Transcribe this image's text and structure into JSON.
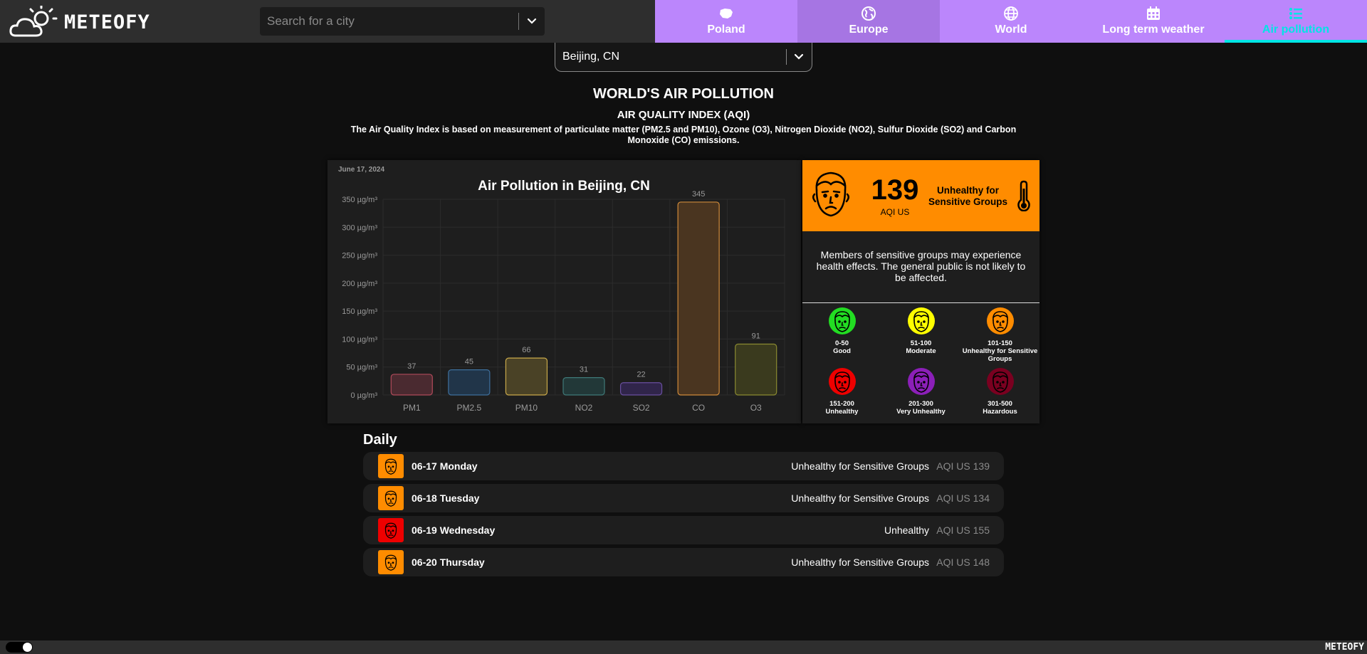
{
  "header": {
    "logo_text": "METEOFY",
    "search_placeholder": "Search for a city",
    "nav": [
      {
        "label": "Poland",
        "icon": "poland-map-icon"
      },
      {
        "label": "Europe",
        "icon": "globe-europe-icon"
      },
      {
        "label": "World",
        "icon": "globe-icon"
      },
      {
        "label": "Long term weather",
        "icon": "calendar-icon"
      },
      {
        "label": "Air pollution",
        "icon": "list-icon"
      }
    ],
    "accent": "#bb86fc",
    "active_color": "#00e5e5"
  },
  "city_select": {
    "value": "Beijing, CN"
  },
  "page": {
    "title": "WORLD'S AIR POLLUTION",
    "aqi_title": "AIR QUALITY INDEX (AQI)",
    "aqi_description": "The Air Quality Index is based on measurement of particulate matter (PM2.5 and PM10), Ozone (O3), Nitrogen Dioxide (NO2), Sulfur Dioxide (SO2) and Carbon Monoxide (CO) emissions."
  },
  "chart_date": "June 17, 2024",
  "chart_data": {
    "type": "bar",
    "title": "Air Pollution in Beijing, CN",
    "categories": [
      "PM1",
      "PM2.5",
      "PM10",
      "NO2",
      "SO2",
      "CO",
      "O3"
    ],
    "values": [
      37,
      45,
      66,
      31,
      22,
      345,
      91
    ],
    "y_ticks": [
      "0 µg/m³",
      "50 µg/m³",
      "100 µg/m³",
      "150 µg/m³",
      "200 µg/m³",
      "250 µg/m³",
      "300 µg/m³",
      "350 µg/m³"
    ],
    "ylim": [
      0,
      350
    ],
    "grid": true,
    "bar_colors": [
      {
        "fill": "#4a2a30",
        "stroke": "#b04a5a"
      },
      {
        "fill": "#213549",
        "stroke": "#3e6f9c"
      },
      {
        "fill": "#4a4226",
        "stroke": "#c9a94a"
      },
      {
        "fill": "#223838",
        "stroke": "#3f7a78"
      },
      {
        "fill": "#30254a",
        "stroke": "#6a4fa0"
      },
      {
        "fill": "#4a3520",
        "stroke": "#d08a3a"
      },
      {
        "fill": "#3a3a1e",
        "stroke": "#8a8a30"
      }
    ]
  },
  "aqi_card": {
    "value": "139",
    "unit": "AQI US",
    "level": "Unhealthy for Sensitive Groups",
    "color": "#ff8c00",
    "message": "Members of sensitive groups may experience health effects. The general public is not likely to be affected.",
    "legend": [
      {
        "range": "0-50",
        "name": "Good",
        "color": "#22dd22"
      },
      {
        "range": "51-100",
        "name": "Moderate",
        "color": "#ffff00"
      },
      {
        "range": "101-150",
        "name": "Unhealthy for Sensitive Groups",
        "color": "#ff8c00"
      },
      {
        "range": "151-200",
        "name": "Unhealthy",
        "color": "#ee0000"
      },
      {
        "range": "201-300",
        "name": "Very Unhealthy",
        "color": "#8b1fb8"
      },
      {
        "range": "301-500",
        "name": "Hazardous",
        "color": "#7a0020"
      }
    ]
  },
  "daily": {
    "title": "Daily",
    "rows": [
      {
        "date": "06-17 Monday",
        "level": "Unhealthy for Sensitive Groups",
        "aqi": "AQI US 139",
        "color": "#ff8c00"
      },
      {
        "date": "06-18 Tuesday",
        "level": "Unhealthy for Sensitive Groups",
        "aqi": "AQI US 134",
        "color": "#ff8c00"
      },
      {
        "date": "06-19 Wednesday",
        "level": "Unhealthy",
        "aqi": "AQI US 155",
        "color": "#ee0000"
      },
      {
        "date": "06-20 Thursday",
        "level": "Unhealthy for Sensitive Groups",
        "aqi": "AQI US 148",
        "color": "#ff8c00"
      }
    ]
  },
  "footer": {
    "logo_text": "METEOFY"
  }
}
